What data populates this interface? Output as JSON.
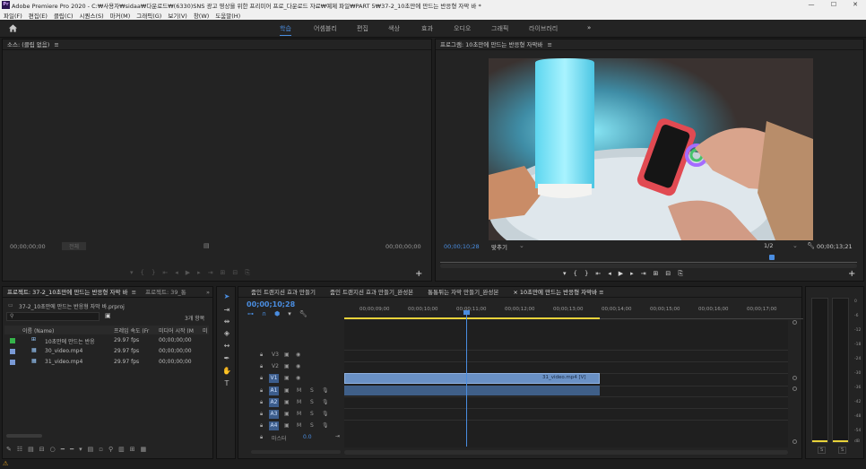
{
  "titlebar": {
    "logo": "Pr",
    "title": "Adobe Premiere Pro 2020 - C:₩사용자₩sidaa₩다운로드₩(6330)SNS 광고 영상을 위한 프리미어 프로_다운로드 자료₩예제 파일₩PART 5₩37-2_10초만에 만드는 반응형 자막 바 *",
    "min": "—",
    "max": "☐",
    "close": "✕"
  },
  "menu": [
    "파일(F)",
    "편집(E)",
    "클립(C)",
    "시퀀스(S)",
    "마커(M)",
    "그래픽(G)",
    "보기(V)",
    "창(W)",
    "도움말(H)"
  ],
  "workspace": {
    "tabs": [
      "학습",
      "어셈블리",
      "편집",
      "색상",
      "효과",
      "오디오",
      "그래픽",
      "라이브러리"
    ],
    "active_index": 0,
    "more": "»"
  },
  "source": {
    "title": "소스: (클립 없음)",
    "menu_glyph": "≡",
    "tc_left": "00;00;00;00",
    "zoom_label": "전체",
    "tc_right": "00;00;00;00"
  },
  "program": {
    "title": "프로그램: 10초만에 만드는 반응형 자막바",
    "menu_glyph": "≡",
    "tc_left": "00;00;10;28",
    "fit": "맞추기",
    "resolution": "1/2",
    "tc_right": "00;00;13;21"
  },
  "project": {
    "tab1": "프로젝트: 37-2_10초만에 만드는 반응형 자막 바",
    "tab2": "프로젝트: 39_통",
    "file": "37-2_10초만에 만드는 반응형 자막 바.prproj",
    "count": "3개 항목",
    "col_name": "이름 (Name)",
    "col_fps": "프레임 속도 (Fr",
    "col_start": "미디어 시작 (M",
    "col_x": "미",
    "items": [
      {
        "name": "10초만에 만드는 반응",
        "fps": "29.97 fps",
        "start": "00;00;00;00",
        "color": "#35b34a"
      },
      {
        "name": "30_video.mp4",
        "fps": "29.97 fps",
        "start": "00;00;00;00",
        "color": "#7a9ad6"
      },
      {
        "name": "31_video.mp4",
        "fps": "29.97 fps",
        "start": "00;00;00;00",
        "color": "#7a9ad6"
      }
    ]
  },
  "timeline": {
    "tabs": [
      "줌인 트랜지션 효과 만들기",
      "줌인 트랜지션 효과 만들기_완성본",
      "통통튀는 자막 만들기_완성본",
      "10초만에 만드는 반응형 자막바"
    ],
    "active_index": 3,
    "timecode": "00;00;10;28",
    "ruler": [
      "00;00;09;00",
      "00;00;10;00",
      "00;00;11;00",
      "00;00;12;00",
      "00;00;13;00",
      "00;00;14;00",
      "00;00;15;00",
      "00;00;16;00",
      "00;00;17;00"
    ],
    "video_tracks": [
      "V3",
      "V2",
      "V1"
    ],
    "audio_tracks": [
      "A1",
      "A2",
      "A3",
      "A4"
    ],
    "master": "마스터",
    "master_val": "0.0",
    "clip_label": "31_video.mp4 [V]",
    "m": "M",
    "s": "S"
  },
  "meter": {
    "scale": [
      "0",
      "-6",
      "-12",
      "-18",
      "-24",
      "-30",
      "-36",
      "-42",
      "-48",
      "-54",
      "dB"
    ],
    "s1": "S",
    "s2": "S"
  }
}
